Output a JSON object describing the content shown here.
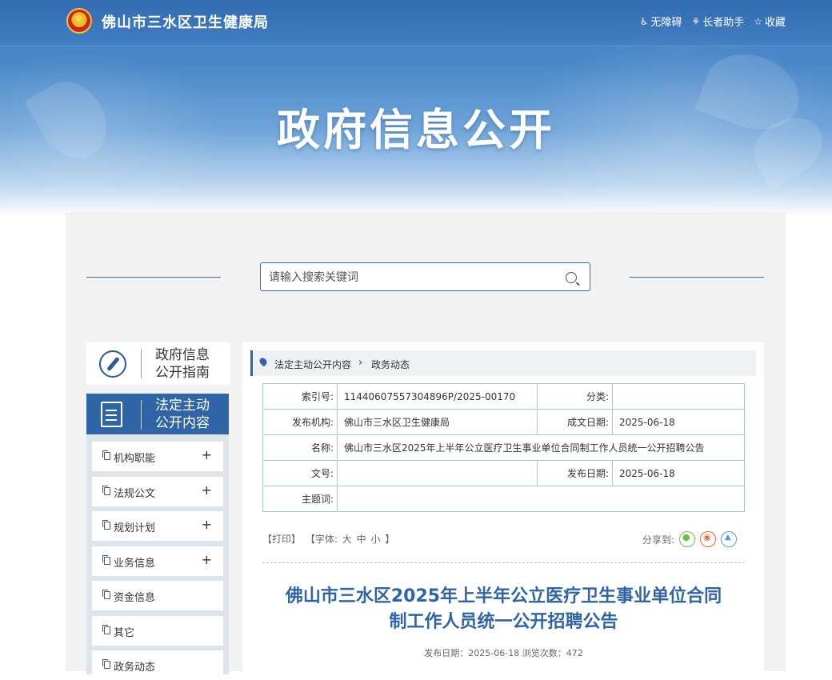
{
  "header": {
    "site_name": "佛山市三水区卫生健康局",
    "links": [
      {
        "label": "无障碍",
        "icon": "accessibility-icon"
      },
      {
        "label": "长者助手",
        "icon": "elder-helper-icon"
      },
      {
        "label": "收藏",
        "icon": "star-icon"
      }
    ],
    "hero_title": "政府信息公开"
  },
  "search": {
    "placeholder": "请输入搜索关键词"
  },
  "sidebar": {
    "guide_label": "政府信息公开指南",
    "active_label": "法定主动公开内容",
    "items": [
      {
        "label": "机构职能",
        "expandable": "+"
      },
      {
        "label": "法规公文",
        "expandable": "+"
      },
      {
        "label": "规划计划",
        "expandable": "+"
      },
      {
        "label": "业务信息",
        "expandable": "+"
      },
      {
        "label": "资金信息",
        "expandable": ""
      },
      {
        "label": "其它",
        "expandable": ""
      },
      {
        "label": "政务动态",
        "expandable": ""
      }
    ]
  },
  "breadcrumb": {
    "level1": "法定主动公开内容",
    "separator": "›",
    "level2": "政务动态"
  },
  "meta": {
    "index_label": "索引号:",
    "index_value": "11440607557304896P/2025-00170",
    "category_label": "分类:",
    "category_value": "",
    "publisher_label": "发布机构:",
    "publisher_value": "佛山市三水区卫生健康局",
    "created_label": "成文日期:",
    "created_value": "2025-06-18",
    "name_label": "名称:",
    "name_value": "佛山市三水区2025年上半年公立医疗卫生事业单位合同制工作人员统一公开招聘公告",
    "docno_label": "文号:",
    "docno_value": "",
    "published_label": "发布日期:",
    "published_value": "2025-06-18",
    "subject_label": "主题词:",
    "subject_value": ""
  },
  "tools": {
    "print": "【打印】",
    "font_prefix": "【字体:",
    "font_large": "大",
    "font_medium": "中",
    "font_small": "小",
    "font_suffix": "】",
    "share_label": "分享到:"
  },
  "article": {
    "title_line1": "佛山市三水区2025年上半年公立医疗卫生事业单位合同",
    "title_line2": "制工作人员统一公开招聘公告",
    "meta": "发布日期：2025-06-18  浏览次数：472"
  }
}
